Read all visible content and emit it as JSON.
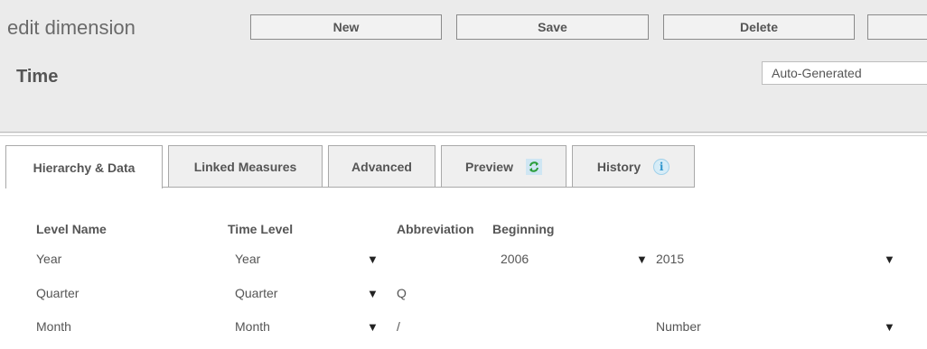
{
  "header": {
    "title": "edit dimension",
    "dimension_name": "Time",
    "generation_mode": "Auto-Generated"
  },
  "toolbar": {
    "new_label": "New",
    "save_label": "Save",
    "delete_label": "Delete"
  },
  "tabs": [
    {
      "label": "Hierarchy & Data",
      "active": true
    },
    {
      "label": "Linked Measures",
      "active": false
    },
    {
      "label": "Advanced",
      "active": false
    },
    {
      "label": "Preview",
      "active": false,
      "icon": "refresh-icon"
    },
    {
      "label": "History",
      "active": false,
      "icon": "info-icon"
    }
  ],
  "table": {
    "headers": {
      "level_name": "Level Name",
      "time_level": "Time Level",
      "abbreviation": "Abbreviation",
      "beginning": "Beginning"
    },
    "rows": [
      {
        "level_name": "Year",
        "time_level": "Year",
        "abbreviation": "",
        "beginning": "2006",
        "end": "2015"
      },
      {
        "level_name": "Quarter",
        "time_level": "Quarter",
        "abbreviation": "Q",
        "beginning": "",
        "end": ""
      },
      {
        "level_name": "Month",
        "time_level": "Month",
        "abbreviation": "/",
        "beginning": "",
        "end": "Number"
      }
    ]
  },
  "colors": {
    "header_bg": "#ebebeb",
    "info_accent": "#2f95cc",
    "refresh_accent": "#2a9d3a"
  }
}
